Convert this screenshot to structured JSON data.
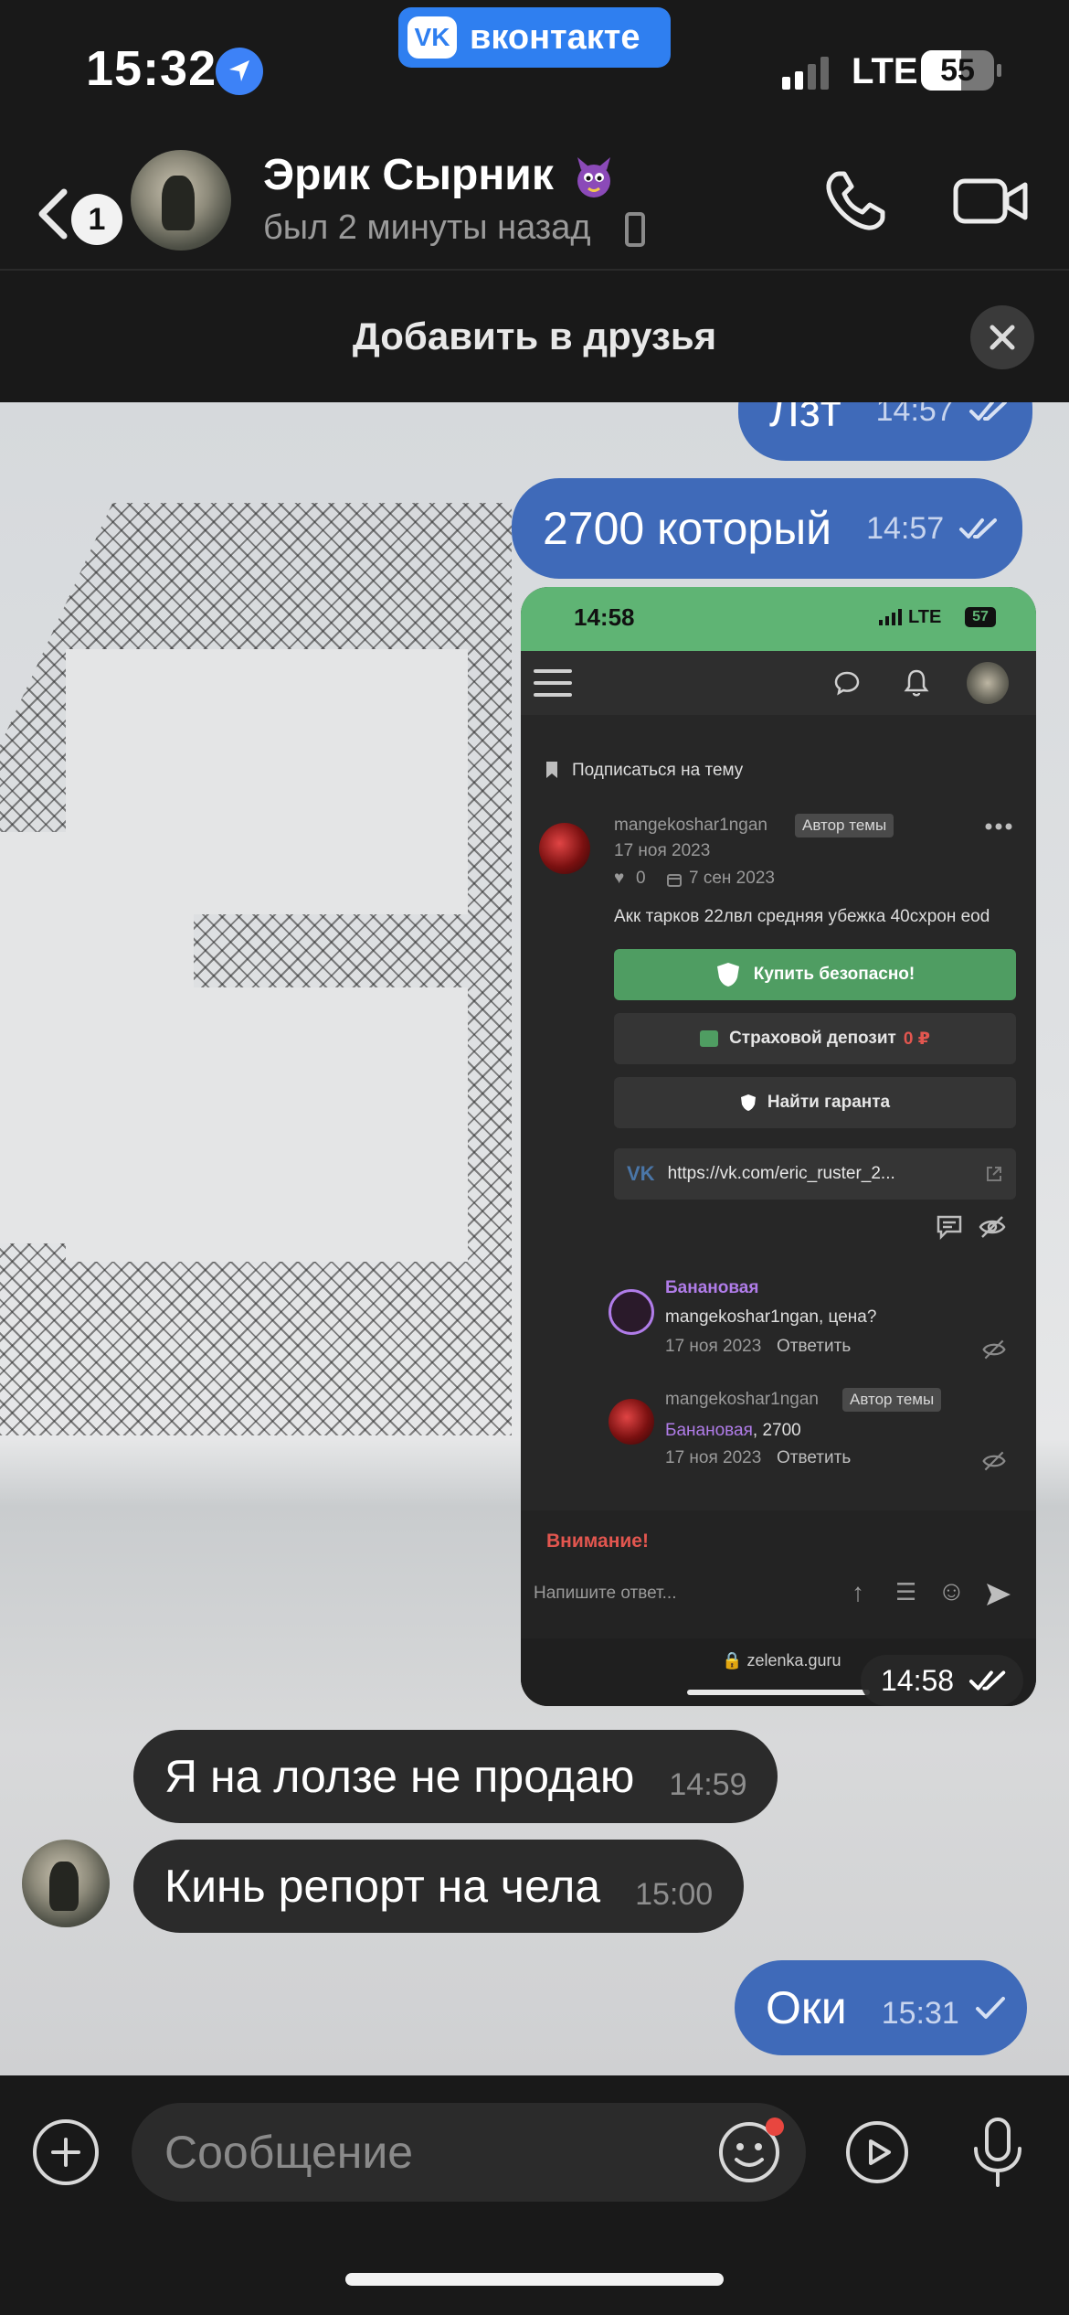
{
  "status_bar": {
    "time": "15:32",
    "network": "LTE",
    "battery": "55",
    "battery_level": 0.55
  },
  "app_pill": {
    "logo": "VK",
    "label": "вконтакте"
  },
  "header": {
    "back_badge": "1",
    "name": "Эрик Сырник",
    "status": "был 2 минуты назад",
    "icons": [
      "back-icon",
      "call-icon",
      "video-icon",
      "phone-device-icon"
    ]
  },
  "banner": {
    "text": "Добавить в друзья"
  },
  "messages": [
    {
      "dir": "out",
      "text": "Лзт",
      "time": "14:57",
      "read": true
    },
    {
      "dir": "out",
      "text": "2700 который",
      "time": "14:57",
      "read": true
    },
    {
      "dir": "out",
      "type": "image",
      "time": "14:58",
      "read": true
    },
    {
      "dir": "in",
      "text": "Я на лолзе не продаю",
      "time": "14:59"
    },
    {
      "dir": "in",
      "text": "Кинь репорт на чела",
      "time": "15:00"
    },
    {
      "dir": "out",
      "text": "Оки",
      "time": "15:31",
      "read": false
    }
  ],
  "screenshot": {
    "time": "14:58",
    "network": "LTE",
    "battery": "57",
    "subscribe": "Подписаться на тему",
    "post": {
      "author": "mangekoshar1ngan",
      "author_tag": "Автор темы",
      "date": "17 ноя 2023",
      "likes": "0",
      "edit_date": "7 сен 2023",
      "text": "Акк тарков 22лвл средняя убежка 40схрон eod",
      "buy_button": "Купить безопасно!",
      "deposit_label": "Страховой депозит",
      "deposit_value": "0 ₽",
      "guarantor_button": "Найти гаранта",
      "link": "https://vk.com/eric_ruster_2..."
    },
    "comments": [
      {
        "author": "Банановая",
        "text_mention": "mangekoshar1ngan",
        "text": ", цена?",
        "date": "17 ноя 2023",
        "reply": "Ответить"
      },
      {
        "author": "mangekoshar1ngan",
        "tag": "Автор темы",
        "text_mention": "Банановая",
        "text": ", 2700",
        "date": "17 ноя 2023",
        "reply": "Ответить"
      }
    ],
    "warning": "Внимание!",
    "reply_placeholder": "Напишите ответ...",
    "domain": "zelenka.guru"
  },
  "composer": {
    "placeholder": "Сообщение"
  },
  "colors": {
    "accent": "#3f6ab9",
    "incoming": "#2b2b2b",
    "vk_blue": "#2f7ff0",
    "forum_green": "#5fb474"
  }
}
